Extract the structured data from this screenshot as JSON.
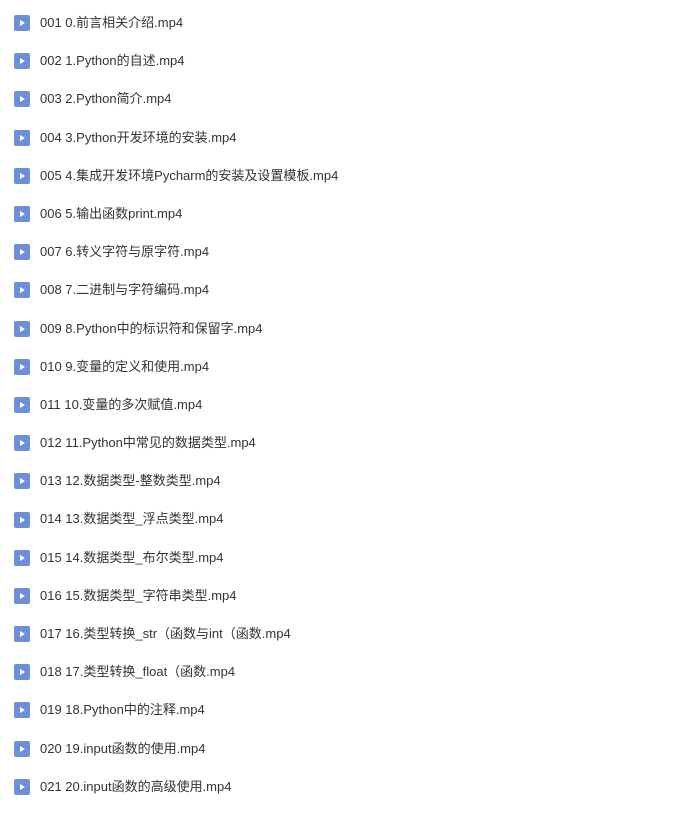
{
  "files": [
    {
      "name": "001 0.前言相关介绍.mp4"
    },
    {
      "name": "002 1.Python的自述.mp4"
    },
    {
      "name": "003 2.Python简介.mp4"
    },
    {
      "name": "004 3.Python开发环境的安装.mp4"
    },
    {
      "name": "005 4.集成开发环境Pycharm的安装及设置模板.mp4"
    },
    {
      "name": "006 5.输出函数print.mp4"
    },
    {
      "name": "007 6.转义字符与原字符.mp4"
    },
    {
      "name": "008 7.二进制与字符编码.mp4"
    },
    {
      "name": "009 8.Python中的标识符和保留字.mp4"
    },
    {
      "name": "010 9.变量的定义和使用.mp4"
    },
    {
      "name": "011 10.变量的多次赋值.mp4"
    },
    {
      "name": "012 11.Python中常见的数据类型.mp4"
    },
    {
      "name": "013 12.数据类型-整数类型.mp4"
    },
    {
      "name": "014 13.数据类型_浮点类型.mp4"
    },
    {
      "name": "015 14.数据类型_布尔类型.mp4"
    },
    {
      "name": "016 15.数据类型_字符串类型.mp4"
    },
    {
      "name": "017 16.类型转换_str（函数与int（函数.mp4"
    },
    {
      "name": "018 17.类型转换_float（函数.mp4"
    },
    {
      "name": "019 18.Python中的注释.mp4"
    },
    {
      "name": "020 19.input函数的使用.mp4"
    },
    {
      "name": "021 20.input函数的高级使用.mp4"
    }
  ]
}
